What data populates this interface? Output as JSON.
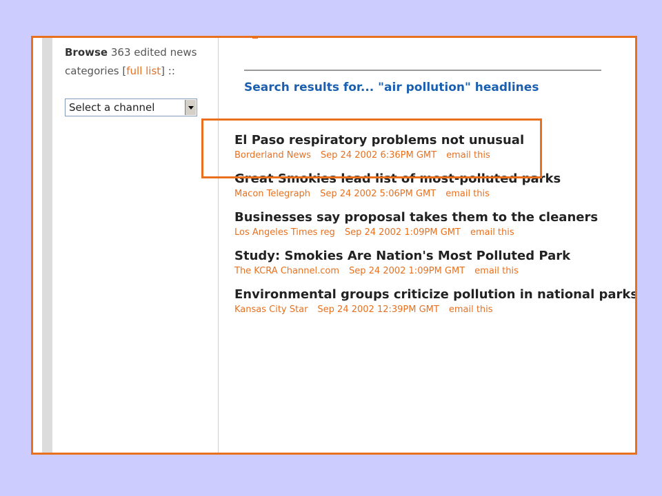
{
  "sidebar": {
    "browse_label": "Browse",
    "browse_text": " 363 edited news categories [",
    "full_list_link": "full list",
    "browse_suffix": "] ::",
    "channel_select": "Select a channel"
  },
  "main": {
    "search_heading": "Search results for... \"air pollution\" headlines",
    "results": [
      {
        "headline": "El Paso respiratory problems not unusual",
        "source": "Borderland News",
        "date": "Sep 24 2002 6:36PM GMT",
        "email": "email this"
      },
      {
        "headline": "Great Smokies lead list of most-polluted parks",
        "source": "Macon Telegraph",
        "date": "Sep 24 2002 5:06PM GMT",
        "email": "email this"
      },
      {
        "headline": "Businesses say proposal takes them to the cleaners",
        "source": "Los Angeles Times reg",
        "date": "Sep 24 2002 1:09PM GMT",
        "email": "email this"
      },
      {
        "headline": "Study: Smokies Are Nation's Most Polluted Park",
        "source": "The KCRA Channel.com",
        "date": "Sep 24 2002 1:09PM GMT",
        "email": "email this"
      },
      {
        "headline": "Environmental groups criticize pollution in national parks",
        "source": "Kansas City Star",
        "date": "Sep 24 2002 12:39PM GMT",
        "email": "email this"
      }
    ]
  },
  "colors": {
    "accent": "#e8701f",
    "link_blue": "#1a5fb0",
    "slide_bg": "#ccccff"
  }
}
